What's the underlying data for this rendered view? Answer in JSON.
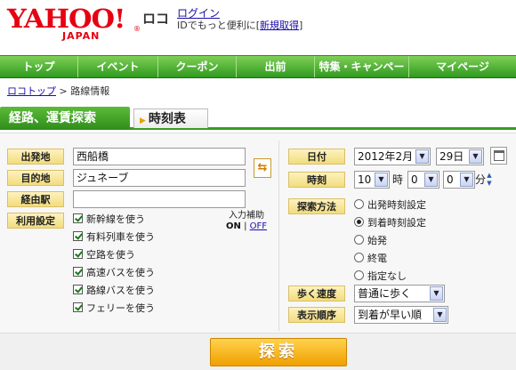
{
  "header": {
    "logo_text": "YAHOO!",
    "logo_sub": "JAPAN",
    "logo_reg": "®",
    "service_name": "ロコ",
    "login_label": "ログイン",
    "login_sub_prefix": "IDでもっと便利に[",
    "register_label": "新規取得",
    "login_sub_suffix": "]"
  },
  "nav": {
    "items": [
      {
        "label": "トップ"
      },
      {
        "label": "イベント"
      },
      {
        "label": "クーポン"
      },
      {
        "label": "出前"
      },
      {
        "label": "特集・キャンペーン"
      },
      {
        "label": "マイページ"
      }
    ]
  },
  "breadcrumb": {
    "root": "ロコトップ",
    "separator": ">",
    "current": "路線情報"
  },
  "tabs": {
    "route": "経路、運賃探索",
    "timetable": "時刻表"
  },
  "form": {
    "departure_label": "出発地",
    "departure_value": "西船橋",
    "destination_label": "目的地",
    "destination_value": "ジュネーブ",
    "via_label": "経由駅",
    "via_value": "",
    "swap_icon": "⇆",
    "options_label": "利用設定",
    "options": [
      {
        "label": "新幹線を使う",
        "checked": true
      },
      {
        "label": "有料列車を使う",
        "checked": true
      },
      {
        "label": "空路を使う",
        "checked": true
      },
      {
        "label": "高速バスを使う",
        "checked": true
      },
      {
        "label": "路線バスを使う",
        "checked": true
      },
      {
        "label": "フェリーを使う",
        "checked": true
      }
    ],
    "assist_label": "入力補助",
    "assist_on": "ON",
    "assist_sep": "|",
    "assist_off": "OFF",
    "date_label": "日付",
    "month_value": "2012年2月",
    "day_value": "29日",
    "time_label": "時刻",
    "hour_value": "10",
    "hour_unit": "時",
    "minute_tens": "0",
    "minute_ones": "0",
    "minute_unit": "分",
    "search_method_label": "探索方法",
    "search_methods": [
      {
        "label": "出発時刻設定",
        "selected": false
      },
      {
        "label": "到着時刻設定",
        "selected": true
      },
      {
        "label": "始発",
        "selected": false
      },
      {
        "label": "終電",
        "selected": false
      },
      {
        "label": "指定なし",
        "selected": false
      }
    ],
    "walk_speed_label": "歩く速度",
    "walk_speed_value": "普通に歩く",
    "sort_label": "表示順序",
    "sort_value": "到着が早い順",
    "dropdown_glyph": "▼"
  },
  "search_button": "探索",
  "colors": {
    "brand_red": "#e60012",
    "nav_green": "#2f9a1f",
    "label_yellow": "#f2dc7d",
    "search_orange": "#f0a000"
  }
}
